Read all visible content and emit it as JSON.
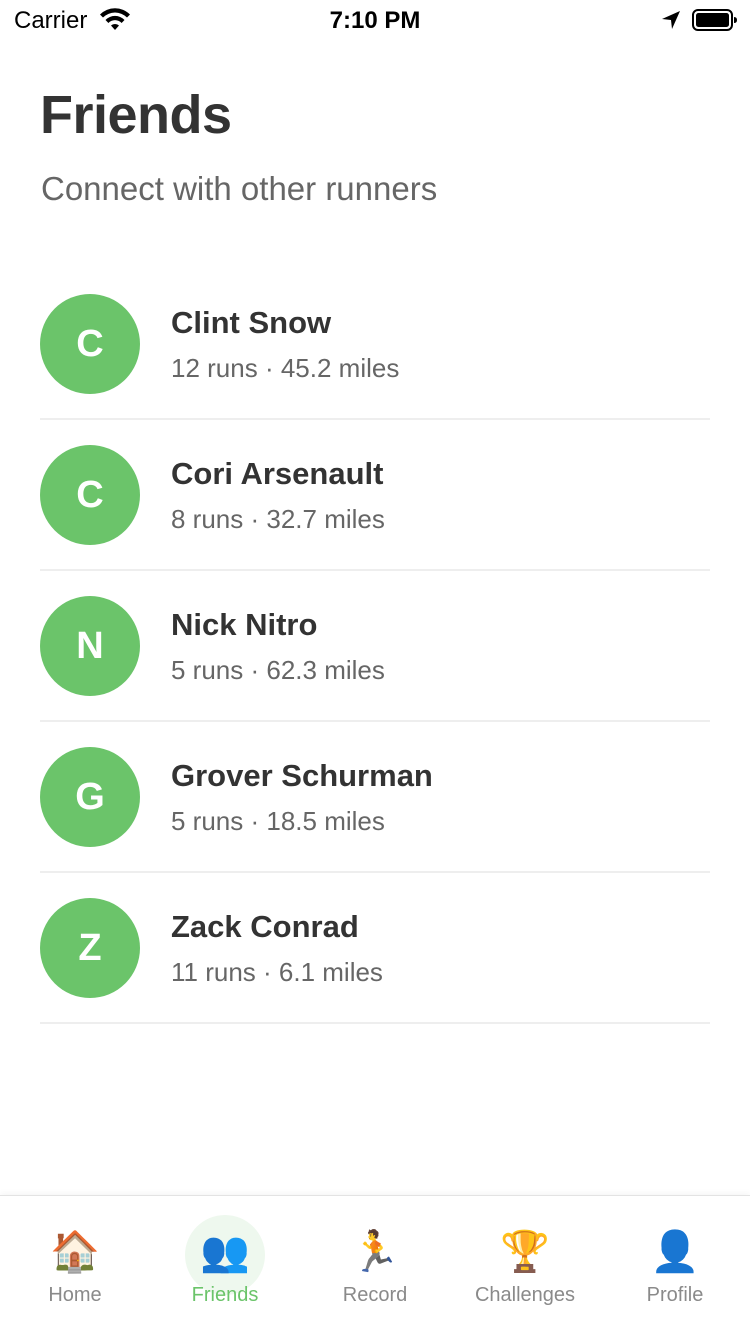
{
  "status_bar": {
    "carrier": "Carrier",
    "time": "7:10 PM",
    "icons": [
      "wifi-icon",
      "location-arrow-icon",
      "battery-icon"
    ]
  },
  "header": {
    "title": "Friends",
    "subtitle": "Connect with other runners"
  },
  "colors": {
    "accent": "#6bc46a",
    "title_text": "#333333",
    "secondary_text": "#666666",
    "divider": "#eeeeee",
    "tab_inactive": "#8a8a8a"
  },
  "friends": [
    {
      "initial": "C",
      "name": "Clint Snow",
      "stats": "12 runs · 45.2 miles"
    },
    {
      "initial": "C",
      "name": "Cori Arsenault",
      "stats": "8 runs · 32.7 miles"
    },
    {
      "initial": "N",
      "name": "Nick Nitro",
      "stats": "5 runs · 62.3 miles"
    },
    {
      "initial": "G",
      "name": "Grover Schurman",
      "stats": "5 runs · 18.5 miles"
    },
    {
      "initial": "Z",
      "name": "Zack Conrad",
      "stats": "11 runs · 6.1 miles"
    }
  ],
  "tab_bar": {
    "active": "Friends",
    "tabs": [
      {
        "label": "Home",
        "icon": "🏠",
        "icon_name": "house-icon"
      },
      {
        "label": "Friends",
        "icon": "👥",
        "icon_name": "people-icon"
      },
      {
        "label": "Record",
        "icon": "🏃",
        "icon_name": "runner-icon"
      },
      {
        "label": "Challenges",
        "icon": "🏆",
        "icon_name": "trophy-icon"
      },
      {
        "label": "Profile",
        "icon": "👤",
        "icon_name": "profile-icon"
      }
    ]
  }
}
